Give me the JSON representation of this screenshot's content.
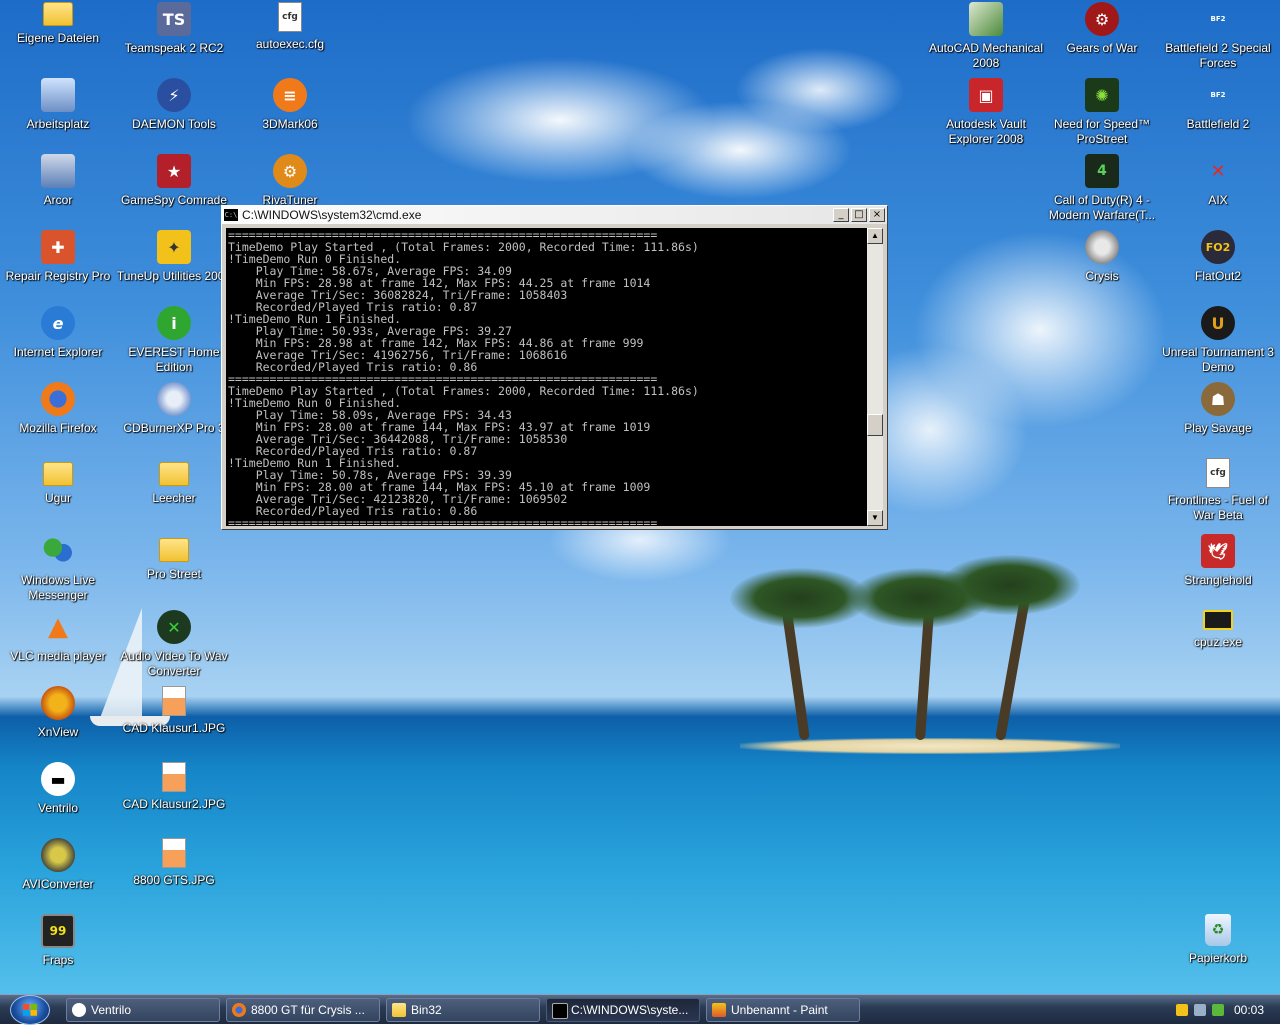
{
  "desktop": {
    "icons": [
      {
        "label": "Eigene Dateien",
        "icon": "my-documents-folder-icon"
      },
      {
        "label": "Teamspeak 2 RC2",
        "icon": "teamspeak-icon"
      },
      {
        "label": "autoexec.cfg",
        "icon": "cfg-file-icon"
      },
      {
        "label": "Arbeitsplatz",
        "icon": "my-computer-icon"
      },
      {
        "label": "DAEMON Tools",
        "icon": "daemon-tools-icon"
      },
      {
        "label": "3DMark06",
        "icon": "3dmark-icon"
      },
      {
        "label": "Arcor",
        "icon": "arcor-icon"
      },
      {
        "label": "GameSpy Comrade",
        "icon": "gamespy-icon"
      },
      {
        "label": "RivaTuner",
        "icon": "rivatuner-icon"
      },
      {
        "label": "Repair Registry Pro",
        "icon": "repair-registry-icon"
      },
      {
        "label": "TuneUp Utilities 2006",
        "icon": "tuneup-icon"
      },
      {
        "label": "Internet Explorer",
        "icon": "internet-explorer-icon"
      },
      {
        "label": "EVEREST Home Edition",
        "icon": "everest-icon"
      },
      {
        "label": "Mozilla Firefox",
        "icon": "firefox-icon"
      },
      {
        "label": "CDBurnerXP Pro 3",
        "icon": "cdburner-icon"
      },
      {
        "label": "Ugur",
        "icon": "folder-icon"
      },
      {
        "label": "Leecher",
        "icon": "folder-icon"
      },
      {
        "label": "Windows Live Messenger",
        "icon": "messenger-icon"
      },
      {
        "label": "Pro Street",
        "icon": "folder-icon"
      },
      {
        "label": "VLC media player",
        "icon": "vlc-icon"
      },
      {
        "label": "Audio Video To Wav Converter",
        "icon": "converter-icon"
      },
      {
        "label": "XnView",
        "icon": "xnview-icon"
      },
      {
        "label": "CAD Klausur1.JPG",
        "icon": "jpg-file-icon"
      },
      {
        "label": "Ventrilo",
        "icon": "ventrilo-icon"
      },
      {
        "label": "CAD Klausur2.JPG",
        "icon": "jpg-file-icon"
      },
      {
        "label": "AVIConverter",
        "icon": "aviconverter-icon"
      },
      {
        "label": "8800 GTS.JPG",
        "icon": "jpg-file-icon"
      },
      {
        "label": "Fraps",
        "icon": "fraps-icon"
      },
      {
        "label": "AutoCAD Mechanical 2008",
        "icon": "autocad-icon"
      },
      {
        "label": "Gears of War",
        "icon": "gears-of-war-icon"
      },
      {
        "label": "Battlefield 2 Special Forces",
        "icon": "battlefield-icon"
      },
      {
        "label": "Autodesk Vault Explorer 2008",
        "icon": "vault-icon"
      },
      {
        "label": "Need for Speed™ ProStreet",
        "icon": "nfs-icon"
      },
      {
        "label": "Battlefield 2",
        "icon": "battlefield-icon"
      },
      {
        "label": "Call of Duty(R) 4 - Modern Warfare(T...",
        "icon": "cod4-icon"
      },
      {
        "label": "AIX",
        "icon": "aix-icon"
      },
      {
        "label": "Crysis",
        "icon": "crysis-icon"
      },
      {
        "label": "FlatOut2",
        "icon": "flatout-icon"
      },
      {
        "label": "Unreal Tournament 3 Demo",
        "icon": "unreal-icon"
      },
      {
        "label": "Play Savage",
        "icon": "savage-icon"
      },
      {
        "label": "Frontlines - Fuel of War Beta",
        "icon": "frontlines-icon"
      },
      {
        "label": "Stranglehold",
        "icon": "stranglehold-icon"
      },
      {
        "label": "cpuz.exe",
        "icon": "cpu-chip-icon"
      },
      {
        "label": "Papierkorb",
        "icon": "recycle-bin-icon"
      }
    ]
  },
  "cmd_window": {
    "title": "C:\\WINDOWS\\system32\\cmd.exe",
    "lines": [
      "==============================================================",
      "TimeDemo Play Started , (Total Frames: 2000, Recorded Time: 111.86s)",
      "!TimeDemo Run 0 Finished.",
      "    Play Time: 58.67s, Average FPS: 34.09",
      "    Min FPS: 28.98 at frame 142, Max FPS: 44.25 at frame 1014",
      "    Average Tri/Sec: 36082824, Tri/Frame: 1058403",
      "    Recorded/Played Tris ratio: 0.87",
      "!TimeDemo Run 1 Finished.",
      "    Play Time: 50.93s, Average FPS: 39.27",
      "    Min FPS: 28.98 at frame 142, Max FPS: 44.86 at frame 999",
      "    Average Tri/Sec: 41962756, Tri/Frame: 1068616",
      "    Recorded/Played Tris ratio: 0.86",
      "==============================================================",
      "TimeDemo Play Started , (Total Frames: 2000, Recorded Time: 111.86s)",
      "!TimeDemo Run 0 Finished.",
      "    Play Time: 58.09s, Average FPS: 34.43",
      "    Min FPS: 28.00 at frame 144, Max FPS: 43.97 at frame 1019",
      "    Average Tri/Sec: 36442088, Tri/Frame: 1058530",
      "    Recorded/Played Tris ratio: 0.87",
      "!TimeDemo Run 1 Finished.",
      "    Play Time: 50.78s, Average FPS: 39.39",
      "    Min FPS: 28.00 at frame 144, Max FPS: 45.10 at frame 1009",
      "    Average Tri/Sec: 42123820, Tri/Frame: 1069502",
      "    Recorded/Played Tris ratio: 0.86",
      "=============================================================="
    ],
    "buttons": {
      "minimize": "_",
      "maximize": "□",
      "close": "×"
    }
  },
  "taskbar": {
    "tasks": [
      {
        "label": "Ventrilo",
        "icon": "ventrilo-icon",
        "active": false
      },
      {
        "label": "8800 GT für Crysis ...",
        "icon": "firefox-icon",
        "active": false
      },
      {
        "label": "Bin32",
        "icon": "folder-icon",
        "active": false
      },
      {
        "label": "C:\\WINDOWS\\syste...",
        "icon": "cmd-icon",
        "active": true
      },
      {
        "label": "Unbenannt - Paint",
        "icon": "paint-icon",
        "active": false
      }
    ],
    "clock": "00:03"
  }
}
